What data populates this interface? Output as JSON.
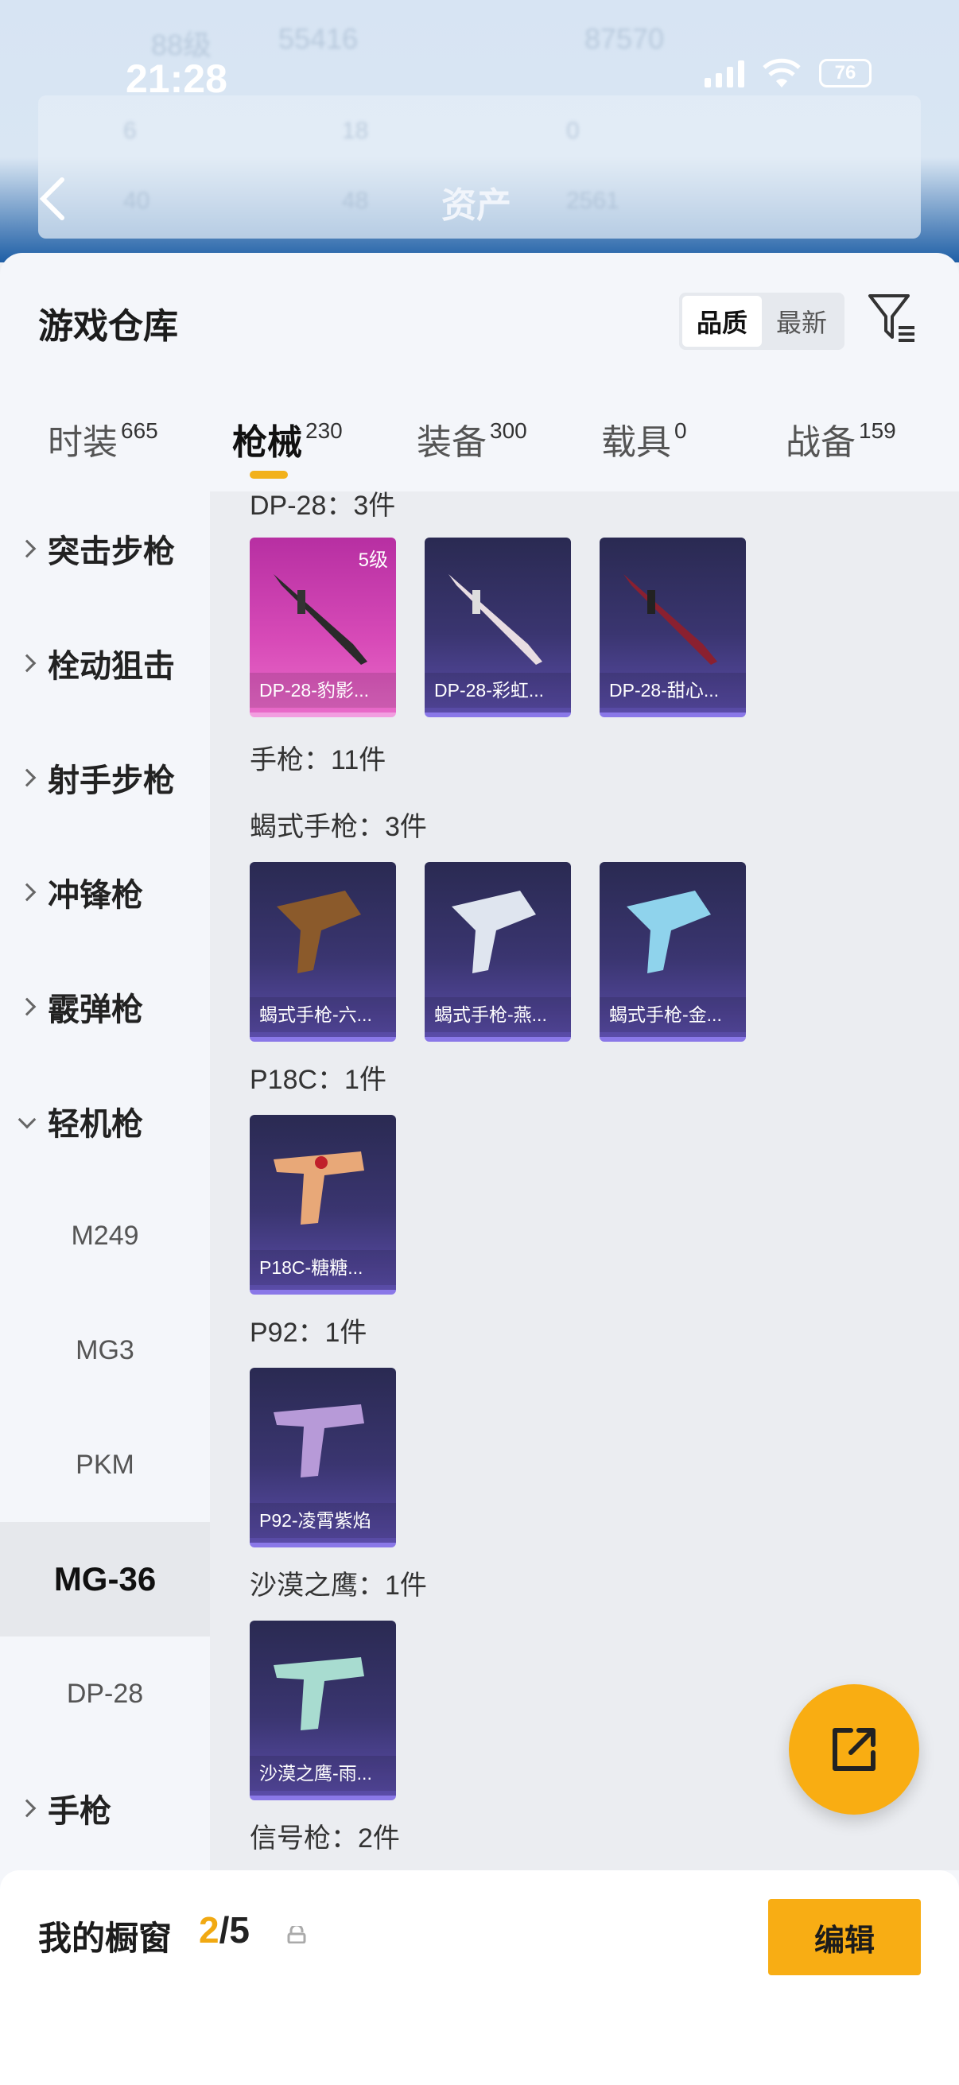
{
  "status": {
    "time": "21:28",
    "battery": "76"
  },
  "header": {
    "back_title": "资产",
    "bg_numbers": [
      "88级",
      "55416",
      "87570",
      "6",
      "18",
      "0",
      "40",
      "48",
      "2561"
    ]
  },
  "sheet": {
    "title": "游戏仓库",
    "sort": {
      "options": [
        "品质",
        "最新"
      ],
      "selected": "品质"
    }
  },
  "tabs": [
    {
      "label": "时装",
      "count": "665"
    },
    {
      "label": "枪械",
      "count": "230",
      "active": true
    },
    {
      "label": "装备",
      "count": "300"
    },
    {
      "label": "载具",
      "count": "0"
    },
    {
      "label": "战备",
      "count": "159"
    }
  ],
  "sidebar": {
    "categories": [
      "突击步枪",
      "栓动狙击",
      "射手步枪",
      "冲锋枪",
      "霰弹枪",
      "轻机枪"
    ],
    "subitems": [
      "M249",
      "MG3",
      "PKM",
      "MG-36",
      "DP-28"
    ],
    "selected_sub": "MG-36",
    "last_category": "手枪"
  },
  "content": {
    "groups": [
      {
        "title": "DP-28：3件"
      },
      {
        "title": "手枪：11件"
      },
      {
        "title": "蝎式手枪：3件"
      },
      {
        "title": "P18C：1件"
      },
      {
        "title": "P92：1件"
      },
      {
        "title": "沙漠之鹰：1件"
      },
      {
        "title": "信号枪：2件"
      }
    ],
    "cards": [
      {
        "name": "DP-28-豹影...",
        "level": "5级"
      },
      {
        "name": "DP-28-彩虹..."
      },
      {
        "name": "DP-28-甜心..."
      },
      {
        "name": "蝎式手枪-六..."
      },
      {
        "name": "蝎式手枪-燕..."
      },
      {
        "name": "蝎式手枪-金..."
      },
      {
        "name": "P18C-糖糖..."
      },
      {
        "name": "P92-凌霄紫焰"
      },
      {
        "name": "沙漠之鹰-雨..."
      }
    ]
  },
  "bottom": {
    "title": "我的橱窗",
    "count_current": "2",
    "count_total": "/5",
    "edit_label": "编辑"
  },
  "colors": {
    "accent": "#f8ad14",
    "card_pink": "#d84bb8",
    "card_purple": "#3a3570"
  },
  "icons": {
    "back": "chevron-left-icon",
    "filter": "filter-icon",
    "share": "share-external-icon",
    "lock": "lock-icon"
  }
}
